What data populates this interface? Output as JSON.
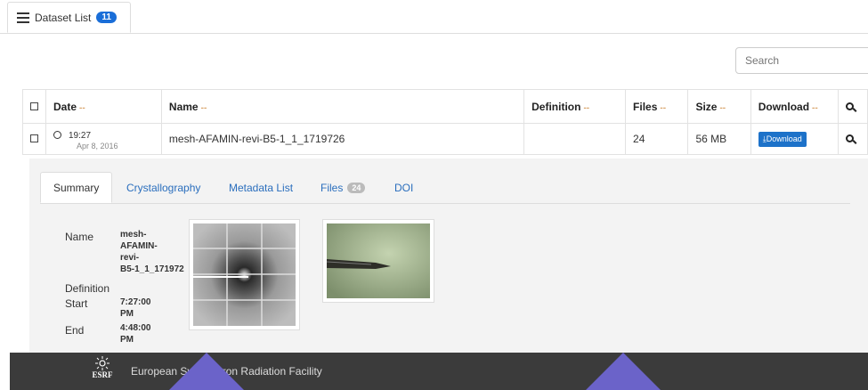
{
  "tabs": {
    "dataset_list_label": "Dataset List",
    "dataset_count": "11"
  },
  "search": {
    "placeholder": "Search"
  },
  "table": {
    "headers": {
      "date": "Date",
      "name": "Name",
      "definition": "Definition",
      "files": "Files",
      "size": "Size",
      "download": "Download"
    },
    "sort_marker": "--",
    "row": {
      "time": "19:27",
      "date": "Apr 8, 2016",
      "name": "mesh-AFAMIN-revi-B5-1_1_1719726",
      "definition": "",
      "files": "24",
      "size": "56 MB",
      "download_label": "Download"
    }
  },
  "detail": {
    "tabs": {
      "summary": "Summary",
      "crystallography": "Crystallography",
      "metadata": "Metadata List",
      "files": "Files",
      "files_count": "24",
      "doi": "DOI"
    },
    "labels": {
      "name": "Name",
      "definition": "Definition",
      "start": "Start",
      "end": "End"
    },
    "values": {
      "name_1": "mesh-",
      "name_2": "AFAMIN-",
      "name_3": "revi-",
      "name_4": "B5-1_1_171972",
      "start_1": "7:27:00",
      "start_2": "PM",
      "end_1": "4:48:00",
      "end_2": "PM"
    }
  },
  "footer": {
    "logo_text": "ESRF",
    "text": "European Synchrotron Radiation Facility"
  },
  "colors": {
    "accent": "#1d72c9",
    "footer_bg": "#3b3b3b",
    "overlay": "#6b63c9"
  }
}
